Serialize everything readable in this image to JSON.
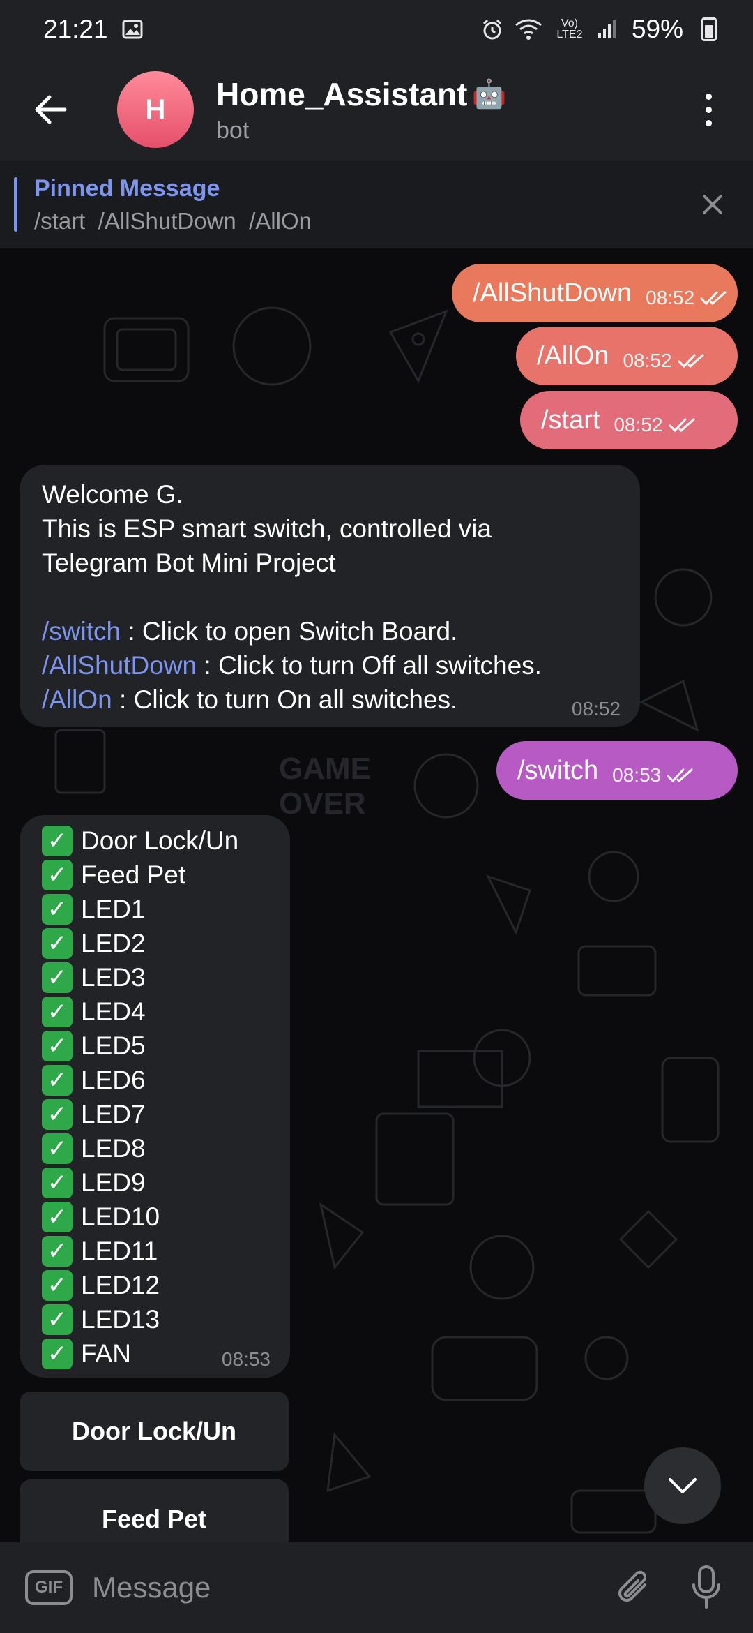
{
  "status_bar": {
    "time": "21:21",
    "battery": "59%",
    "network_label": "Vo) LTE2"
  },
  "header": {
    "avatar_letter": "H",
    "title": "Home_Assistant",
    "title_emoji": "🤖",
    "subtitle": "bot"
  },
  "pinned": {
    "title": "Pinned Message",
    "text": "/start  /AllShutDown  /AllOn"
  },
  "messages_out": [
    {
      "text": "/AllShutDown",
      "time": "08:52",
      "color": "#e8795c"
    },
    {
      "text": "/AllOn",
      "time": "08:52",
      "color": "#e7736a"
    },
    {
      "text": "/start",
      "time": "08:52",
      "color": "#e26c7a"
    },
    {
      "text": "/switch",
      "time": "08:53",
      "color": "#b85ac4"
    }
  ],
  "welcome": {
    "line1": "Welcome G.",
    "line2": "This is ESP smart switch, controlled via",
    "line3": "Telegram Bot Mini Project",
    "cmd1": "/switch",
    "desc1": " : Click to open Switch Board.",
    "cmd2": "/AllShutDown",
    "desc2": " : Click to turn Off all switches.",
    "cmd3": "/AllOn",
    "desc3": " : Click to turn On all switches.",
    "time": "08:52"
  },
  "switch_list": {
    "items": [
      "Door Lock/Un",
      "Feed Pet",
      "LED1",
      "LED2",
      "LED3",
      "LED4",
      "LED5",
      "LED6",
      "LED7",
      "LED8",
      "LED9",
      "LED10",
      "LED11",
      "LED12",
      "LED13",
      "FAN"
    ],
    "time": "08:53",
    "check_color": "#2fa84a"
  },
  "keyboard_buttons": [
    "Door Lock/Un",
    "Feed Pet"
  ],
  "input": {
    "gif_label": "GIF",
    "placeholder": "Message"
  }
}
